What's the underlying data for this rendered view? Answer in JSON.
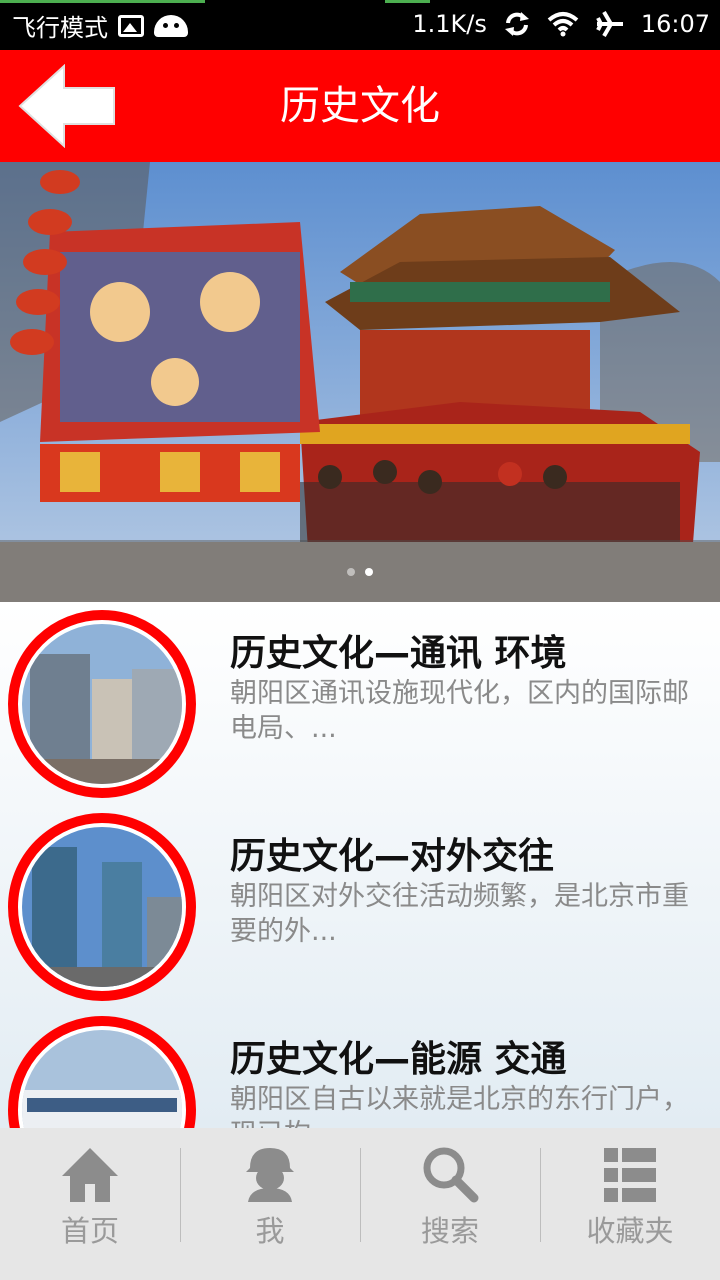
{
  "status_bar": {
    "airplane_label": "飞行模式",
    "net_speed": "1.1K/s",
    "time": "16:07",
    "icons": [
      "image-icon",
      "android-icon",
      "sync-icon",
      "wifi-icon",
      "airplane-icon"
    ]
  },
  "header": {
    "title": "历史文化",
    "back_icon": "back-arrow-icon",
    "color": "#ff0000"
  },
  "banner": {
    "slide_count": 2,
    "active_slide": 2
  },
  "list": {
    "items": [
      {
        "title": "历史文化—通讯 环境",
        "desc": "朝阳区通讯设施现代化，区内的国际邮电局、..."
      },
      {
        "title": "历史文化—对外交往",
        "desc": "朝阳区对外交往活动频繁，是北京市重要的外..."
      },
      {
        "title": "历史文化—能源 交通",
        "desc": "朝阳区自古以来就是北京的东行门户，现已构..."
      }
    ]
  },
  "bottom_nav": {
    "items": [
      {
        "label": "首页",
        "icon": "home-icon"
      },
      {
        "label": "我",
        "icon": "user-icon"
      },
      {
        "label": "搜索",
        "icon": "search-icon"
      },
      {
        "label": "收藏夹",
        "icon": "list-icon"
      }
    ]
  }
}
